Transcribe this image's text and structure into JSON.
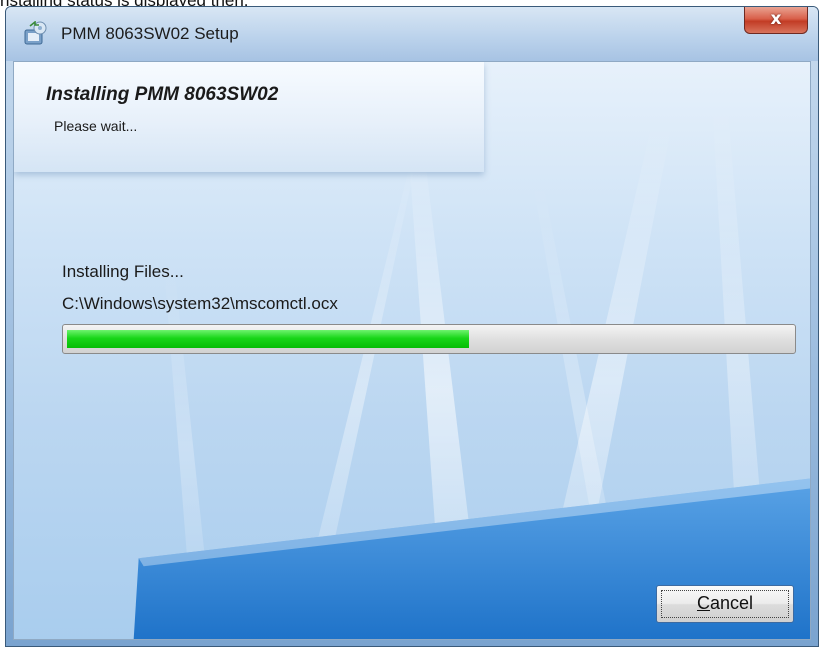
{
  "caption": "nstalling status is displayed then.",
  "window": {
    "title": "PMM 8063SW02 Setup",
    "close_label": "x"
  },
  "header": {
    "title": "Installing PMM 8063SW02",
    "subtitle": "Please wait..."
  },
  "status": {
    "text": "Installing Files...",
    "file": "C:\\Windows\\system32\\mscomctl.ocx"
  },
  "progress": {
    "value": 0.555
  },
  "buttons": {
    "cancel_mnemonic": "C",
    "cancel_rest": "ancel"
  },
  "colors": {
    "progress_fill": "#12d212",
    "close_button": "#c8432b"
  }
}
